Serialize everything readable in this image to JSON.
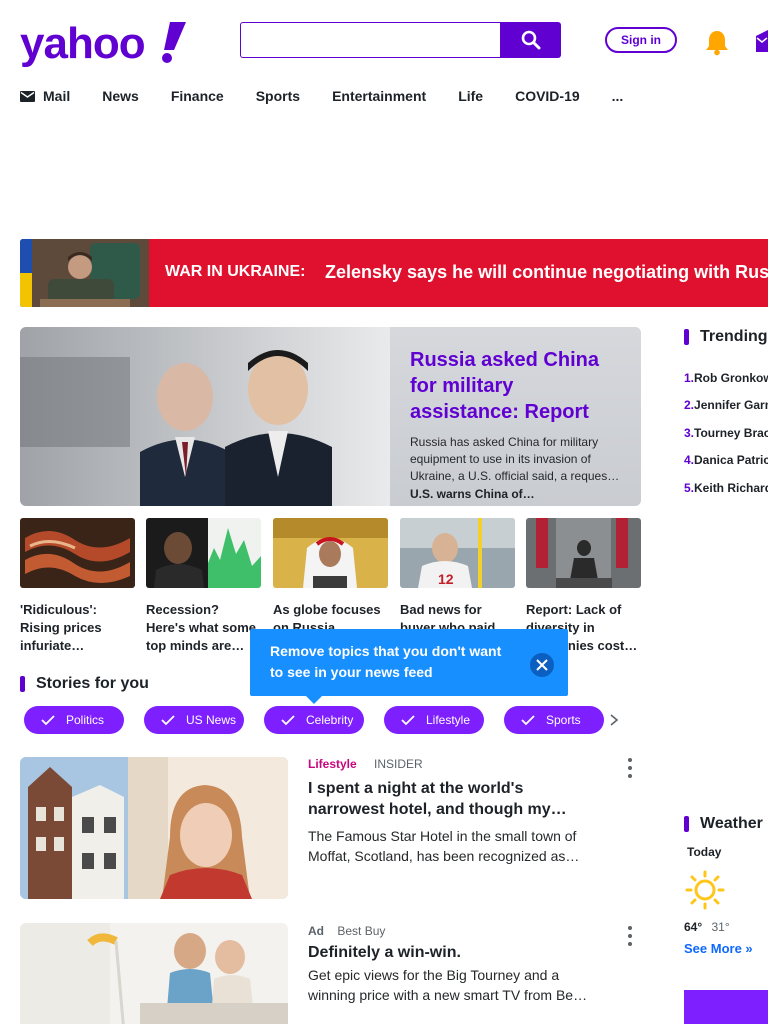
{
  "header": {
    "logo_text": "yahoo!",
    "search_placeholder": "",
    "signin_label": "Sign in"
  },
  "nav": {
    "items": [
      "Mail",
      "News",
      "Finance",
      "Sports",
      "Entertainment",
      "Life",
      "COVID-19",
      "..."
    ]
  },
  "banner": {
    "label": "WAR IN UKRAINE:",
    "headline": "Zelensky says he will continue negotiating with Rus"
  },
  "hero": {
    "title": "Russia asked China for military assistance: Report",
    "description": "Russia has asked China for military equipment to use in its invasion of Ukraine, a U.S. official said, a reques…",
    "related": "U.S. warns China of…"
  },
  "thumbs": [
    {
      "caption": "'Ridiculous': Rising prices infuriate…"
    },
    {
      "caption": "Recession? Here's what some top minds are…"
    },
    {
      "caption": "As globe focuses on Russia,"
    },
    {
      "caption": "Bad news for buyer who paid"
    },
    {
      "caption": "Report: Lack of diversity in companies cost…"
    }
  ],
  "tooltip": {
    "text": "Remove topics that you don't want to see in your news feed"
  },
  "stories": {
    "title": "Stories for you",
    "chips": [
      "Politics",
      "US News",
      "Celebrity",
      "Lifestyle",
      "Sports"
    ]
  },
  "feed": [
    {
      "category": "Lifestyle",
      "source": "INSIDER",
      "title": "I spent a night at the world's narrowest hotel, and though my…",
      "description": "The Famous Star Hotel in the small town of Moffat, Scotland, has been recognized as…"
    },
    {
      "ad_label": "Ad",
      "source": "Best Buy",
      "title": "Definitely a win-win.",
      "description": "Get epic views for the Big Tourney and a winning price with a new smart TV from Be…"
    }
  ],
  "trending": {
    "title": "Trending",
    "items": [
      {
        "rank": "1.",
        "text": "Rob Gronkowski"
      },
      {
        "rank": "2.",
        "text": "Jennifer Garner"
      },
      {
        "rank": "3.",
        "text": "Tourney Bracket"
      },
      {
        "rank": "4.",
        "text": "Danica Patrick"
      },
      {
        "rank": "5.",
        "text": "Keith Richards"
      }
    ]
  },
  "weather": {
    "title": "Weather",
    "day": "Today",
    "high": "64°",
    "low": "31°",
    "see_more": "See More »"
  },
  "colors": {
    "brand": "#6001d2",
    "banner": "#e0112e",
    "chip": "#7e1fff",
    "tooltip": "#188fff"
  }
}
